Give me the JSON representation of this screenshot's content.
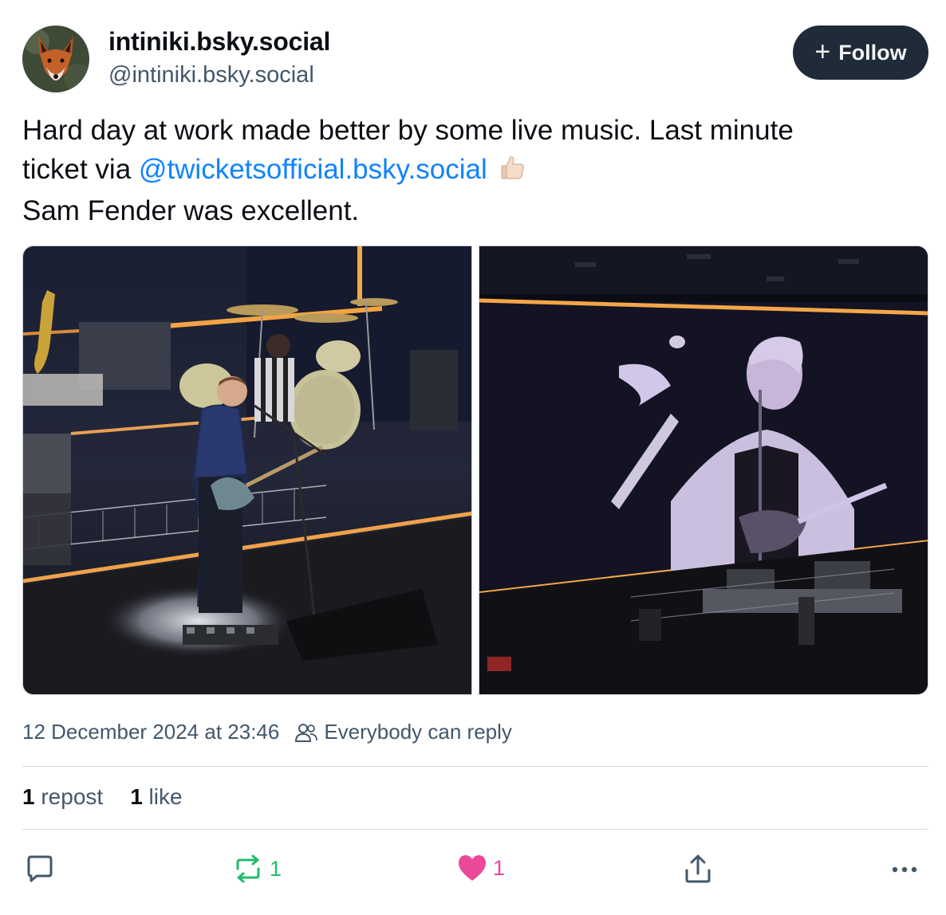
{
  "author": {
    "display_name": "intiniki.bsky.social",
    "handle": "@intiniki.bsky.social",
    "avatar_icon": "fox-avatar"
  },
  "follow_button": {
    "label": "Follow",
    "icon": "plus-icon"
  },
  "post": {
    "text_line1": "Hard day at work made better by some live music. Last minute",
    "text_line2_prefix": "ticket via ",
    "mention": "@twicketsofficial.bsky.social",
    "emoji": "👍🏻",
    "text_line3": "Sam Fender was excellent.",
    "images": [
      {
        "name": "guitarist-on-stage-photo"
      },
      {
        "name": "stage-big-screen-photo"
      }
    ]
  },
  "meta": {
    "timestamp": "12 December 2024 at 23:46",
    "reply_setting": "Everybody can reply"
  },
  "counts": {
    "reposts_num": "1",
    "reposts_label": "repost",
    "likes_num": "1",
    "likes_label": "like"
  },
  "actions": {
    "reply_count": "",
    "repost_count": "1",
    "like_count": "1"
  },
  "colors": {
    "mention": "#1083fe",
    "repost_active": "#20bc6b",
    "like_active": "#ec4899",
    "follow_bg": "#1f2b38"
  }
}
